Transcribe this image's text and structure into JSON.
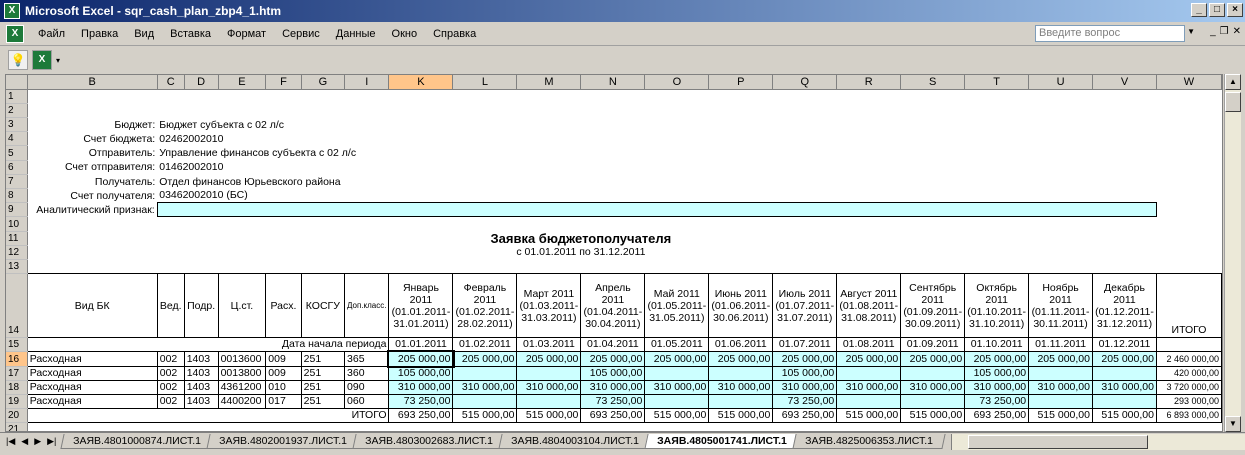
{
  "window": {
    "title": "Microsoft Excel - sqr_cash_plan_zbp4_1.htm",
    "icon_letter": "X"
  },
  "menu": {
    "items": [
      "Файл",
      "Правка",
      "Вид",
      "Вставка",
      "Формат",
      "Сервис",
      "Данные",
      "Окно",
      "Справка"
    ],
    "help_placeholder": "Введите вопрос"
  },
  "columns": [
    "B",
    "C",
    "D",
    "E",
    "F",
    "G",
    "I",
    "K",
    "L",
    "M",
    "N",
    "O",
    "P",
    "Q",
    "R",
    "S",
    "T",
    "U",
    "V",
    "W"
  ],
  "rows": [
    "1",
    "2",
    "3",
    "4",
    "5",
    "6",
    "7",
    "8",
    "9",
    "10",
    "11",
    "12",
    "13",
    "14",
    "15",
    "16",
    "17",
    "18",
    "19",
    "20",
    "21",
    "22"
  ],
  "header_info": [
    {
      "label": "Бюджет:",
      "value": "Бюджет субъекта с 02 л/с"
    },
    {
      "label": "Счет бюджета:",
      "value": "02462002010"
    },
    {
      "label": "Отправитель:",
      "value": "Управление финансов субъекта с 02 л/с"
    },
    {
      "label": "Счет отправителя:",
      "value": "01462002010"
    },
    {
      "label": "Получатель:",
      "value": "Отдел финансов Юрьевского района"
    },
    {
      "label": "Счет получателя:",
      "value": "03462002010 (БС)"
    }
  ],
  "analytic_label": "Аналитический признак:",
  "doc_title": "Заявка бюджетополучателя",
  "doc_period": "с 01.01.2011 по 31.12.2011",
  "table_headers": {
    "vid_bk": "Вид БК",
    "ved": "Вед.",
    "podr": "Подр.",
    "cst": "Ц.ст.",
    "rash": "Расх.",
    "kosgu": "КОСГУ",
    "dopklass": "Доп.класс.",
    "months": [
      "Январь 2011 (01.01.2011-31.01.2011)",
      "Февраль 2011 (01.02.2011-28.02.2011)",
      "Март 2011 (01.03.2011-31.03.2011)",
      "Апрель 2011 (01.04.2011-30.04.2011)",
      "Май 2011 (01.05.2011-31.05.2011)",
      "Июнь 2011 (01.06.2011-30.06.2011)",
      "Июль 2011 (01.07.2011-31.07.2011)",
      "Август 2011 (01.08.2011-31.08.2011)",
      "Сентябрь 2011 (01.09.2011-30.09.2011)",
      "Октябрь 2011 (01.10.2011-31.10.2011)",
      "Ноябрь 2011 (01.11.2011-30.11.2011)",
      "Декабрь 2011 (01.12.2011-31.12.2011)"
    ],
    "itogo": "ИТОГО"
  },
  "period_start_label": "Дата начала периода",
  "period_dates": [
    "01.01.2011",
    "01.02.2011",
    "01.03.2011",
    "01.04.2011",
    "01.05.2011",
    "01.06.2011",
    "01.07.2011",
    "01.08.2011",
    "01.09.2011",
    "01.10.2011",
    "01.11.2011",
    "01.12.2011"
  ],
  "data_rows": [
    {
      "vid": "Расходная",
      "ved": "002",
      "podr": "1403",
      "cst": "0013600",
      "rash": "009",
      "kosgu": "251",
      "dop": "365",
      "months": [
        "205 000,00",
        "205 000,00",
        "205 000,00",
        "205 000,00",
        "205 000,00",
        "205 000,00",
        "205 000,00",
        "205 000,00",
        "205 000,00",
        "205 000,00",
        "205 000,00",
        "205 000,00"
      ],
      "total": "2 460 000,00"
    },
    {
      "vid": "Расходная",
      "ved": "002",
      "podr": "1403",
      "cst": "0013800",
      "rash": "009",
      "kosgu": "251",
      "dop": "360",
      "months": [
        "105 000,00",
        "",
        "",
        "105 000,00",
        "",
        "",
        "105 000,00",
        "",
        "",
        "105 000,00",
        "",
        ""
      ],
      "total": "420 000,00"
    },
    {
      "vid": "Расходная",
      "ved": "002",
      "podr": "1403",
      "cst": "4361200",
      "rash": "010",
      "kosgu": "251",
      "dop": "090",
      "months": [
        "310 000,00",
        "310 000,00",
        "310 000,00",
        "310 000,00",
        "310 000,00",
        "310 000,00",
        "310 000,00",
        "310 000,00",
        "310 000,00",
        "310 000,00",
        "310 000,00",
        "310 000,00"
      ],
      "total": "3 720 000,00"
    },
    {
      "vid": "Расходная",
      "ved": "002",
      "podr": "1403",
      "cst": "4400200",
      "rash": "017",
      "kosgu": "251",
      "dop": "060",
      "months": [
        "73 250,00",
        "",
        "",
        "73 250,00",
        "",
        "",
        "73 250,00",
        "",
        "",
        "73 250,00",
        "",
        ""
      ],
      "total": "293 000,00"
    }
  ],
  "totals_label": "ИТОГО",
  "totals": [
    "693 250,00",
    "515 000,00",
    "515 000,00",
    "693 250,00",
    "515 000,00",
    "515 000,00",
    "693 250,00",
    "515 000,00",
    "515 000,00",
    "693 250,00",
    "515 000,00",
    "515 000,00"
  ],
  "grand_total": "6 893 000,00",
  "sheet_tabs": [
    "ЗАЯВ.4801000874.ЛИСТ.1",
    "ЗАЯВ.4802001937.ЛИСТ.1",
    "ЗАЯВ.4803002683.ЛИСТ.1",
    "ЗАЯВ.4804003104.ЛИСТ.1",
    "ЗАЯВ.4805001741.ЛИСТ.1",
    "ЗАЯВ.4825006353.ЛИСТ.1"
  ],
  "active_tab_index": 4,
  "selected_cell": "K16",
  "colors": {
    "title_bar": "#0a246a",
    "cyan_fill": "#ccffff",
    "selected_header": "#ffc58a",
    "excel_green": "#1d7a3a"
  }
}
